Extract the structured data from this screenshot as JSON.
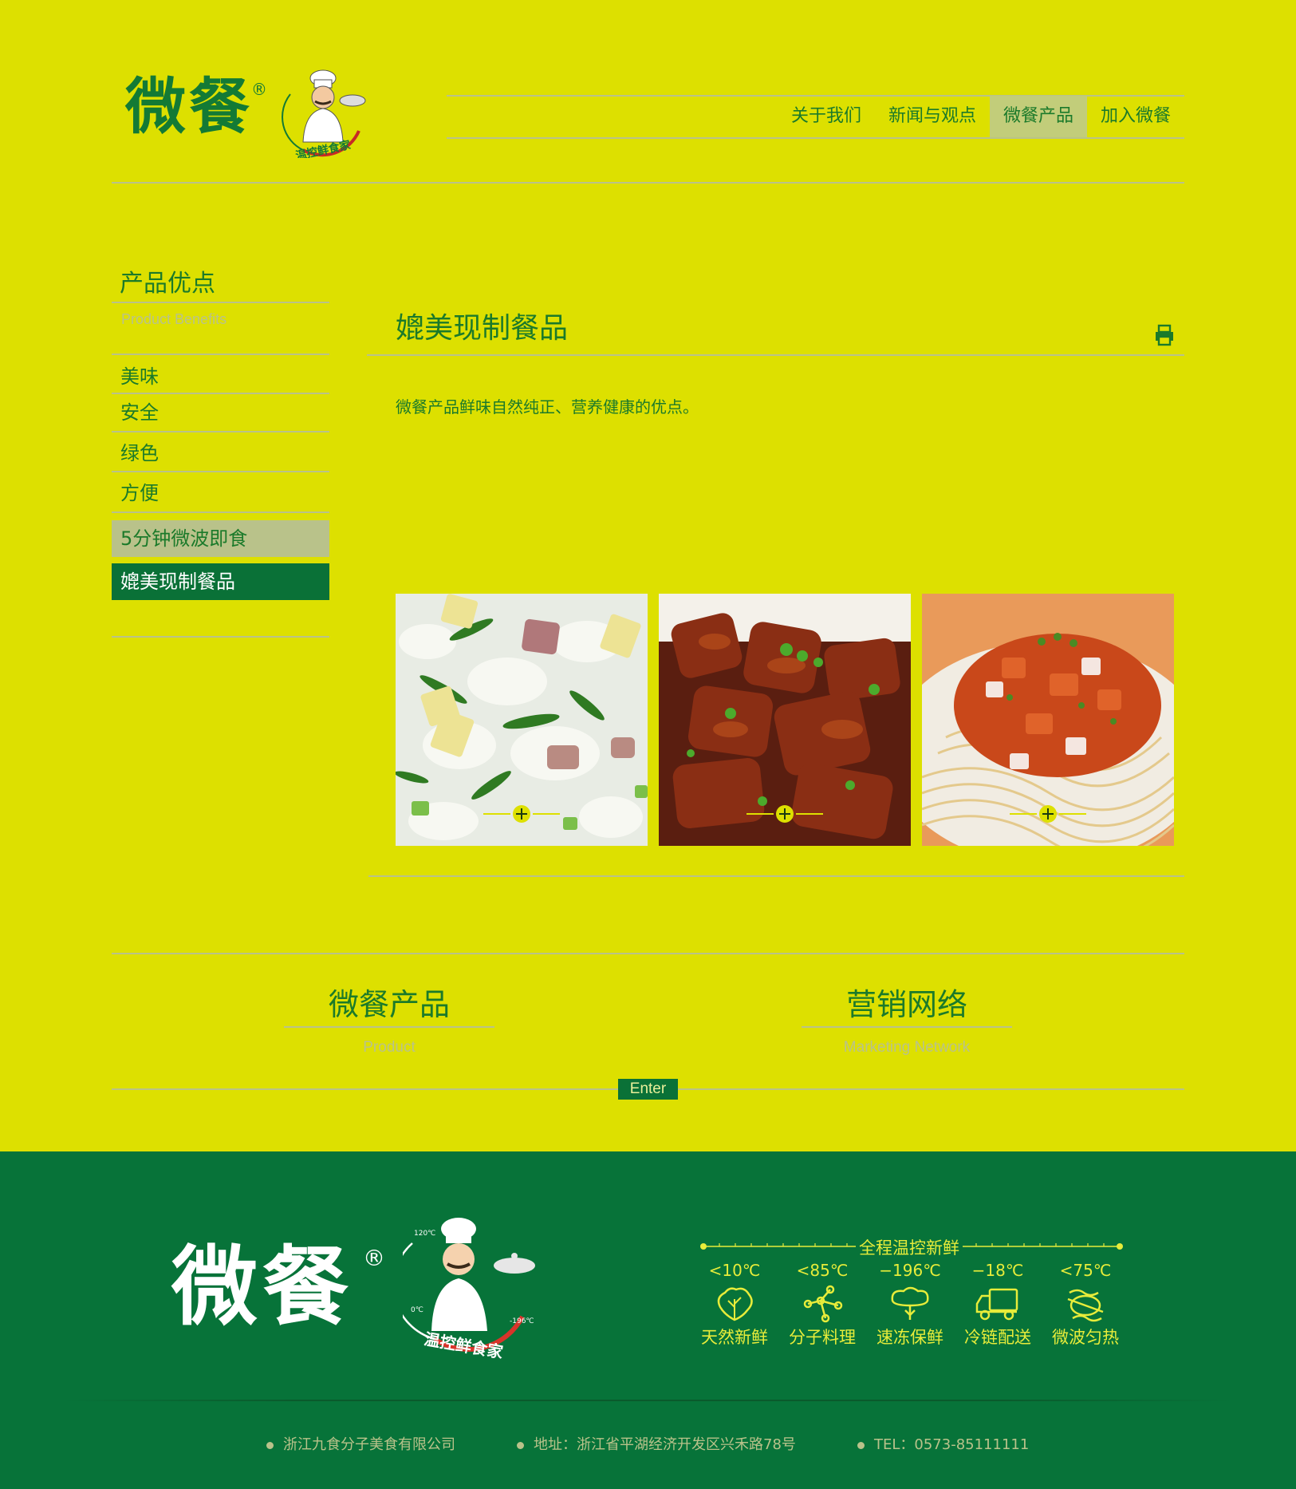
{
  "colors": {
    "background": "#dde000",
    "brand_green": "#0a7137",
    "text_green": "#1b7a2a",
    "muted": "#b9c28a",
    "accent_yellow": "#e7ec3a"
  },
  "header": {
    "logo_text": "微餐",
    "logo_reg": "®",
    "chef_tagline": "温控鲜食家",
    "nav": [
      "关于我们",
      "新闻与观点",
      "微餐产品",
      "加入微餐"
    ],
    "nav_active": "微餐产品"
  },
  "sidebar": {
    "title": "产品优点",
    "subtitle": "Product Benefits",
    "items": [
      "美味",
      "安全",
      "绿色",
      "方便"
    ],
    "highlight_items": [
      "5分钟微波即食",
      "媲美现制餐品"
    ]
  },
  "main": {
    "title": "媲美现制餐品",
    "print_icon": "print-icon",
    "description": "微餐产品鲜味自然纯正、营养健康的优点。",
    "photos": [
      "fried-rice-photo",
      "braised-pork-photo",
      "noodles-photo"
    ]
  },
  "lower": {
    "product_title": "微餐产品",
    "product_sub": "Product",
    "network_title": "营销网络",
    "network_sub": "Marketing Network",
    "enter_label": "Enter"
  },
  "footer": {
    "logo_text": "微餐",
    "logo_reg": "®",
    "chef_tagline": "温控鲜食家",
    "temp_top": "120℃",
    "temp_left": "0℃",
    "temp_right": "-196℃",
    "temp_title": "全程温控新鲜",
    "temps": [
      {
        "value": "<10℃",
        "label": "天然新鲜",
        "icon": "vegetable-icon"
      },
      {
        "value": "<85℃",
        "label": "分子料理",
        "icon": "molecule-icon"
      },
      {
        "value": "−196℃",
        "label": "速冻保鲜",
        "icon": "frozen-icon"
      },
      {
        "value": "−18℃",
        "label": "冷链配送",
        "icon": "truck-icon"
      },
      {
        "value": "<75℃",
        "label": "微波匀热",
        "icon": "microwave-icon"
      }
    ],
    "company": "浙江九食分子美食有限公司",
    "address": "地址：浙江省平湖经济开发区兴禾路78号",
    "tel": "TEL：0573-85111111"
  }
}
